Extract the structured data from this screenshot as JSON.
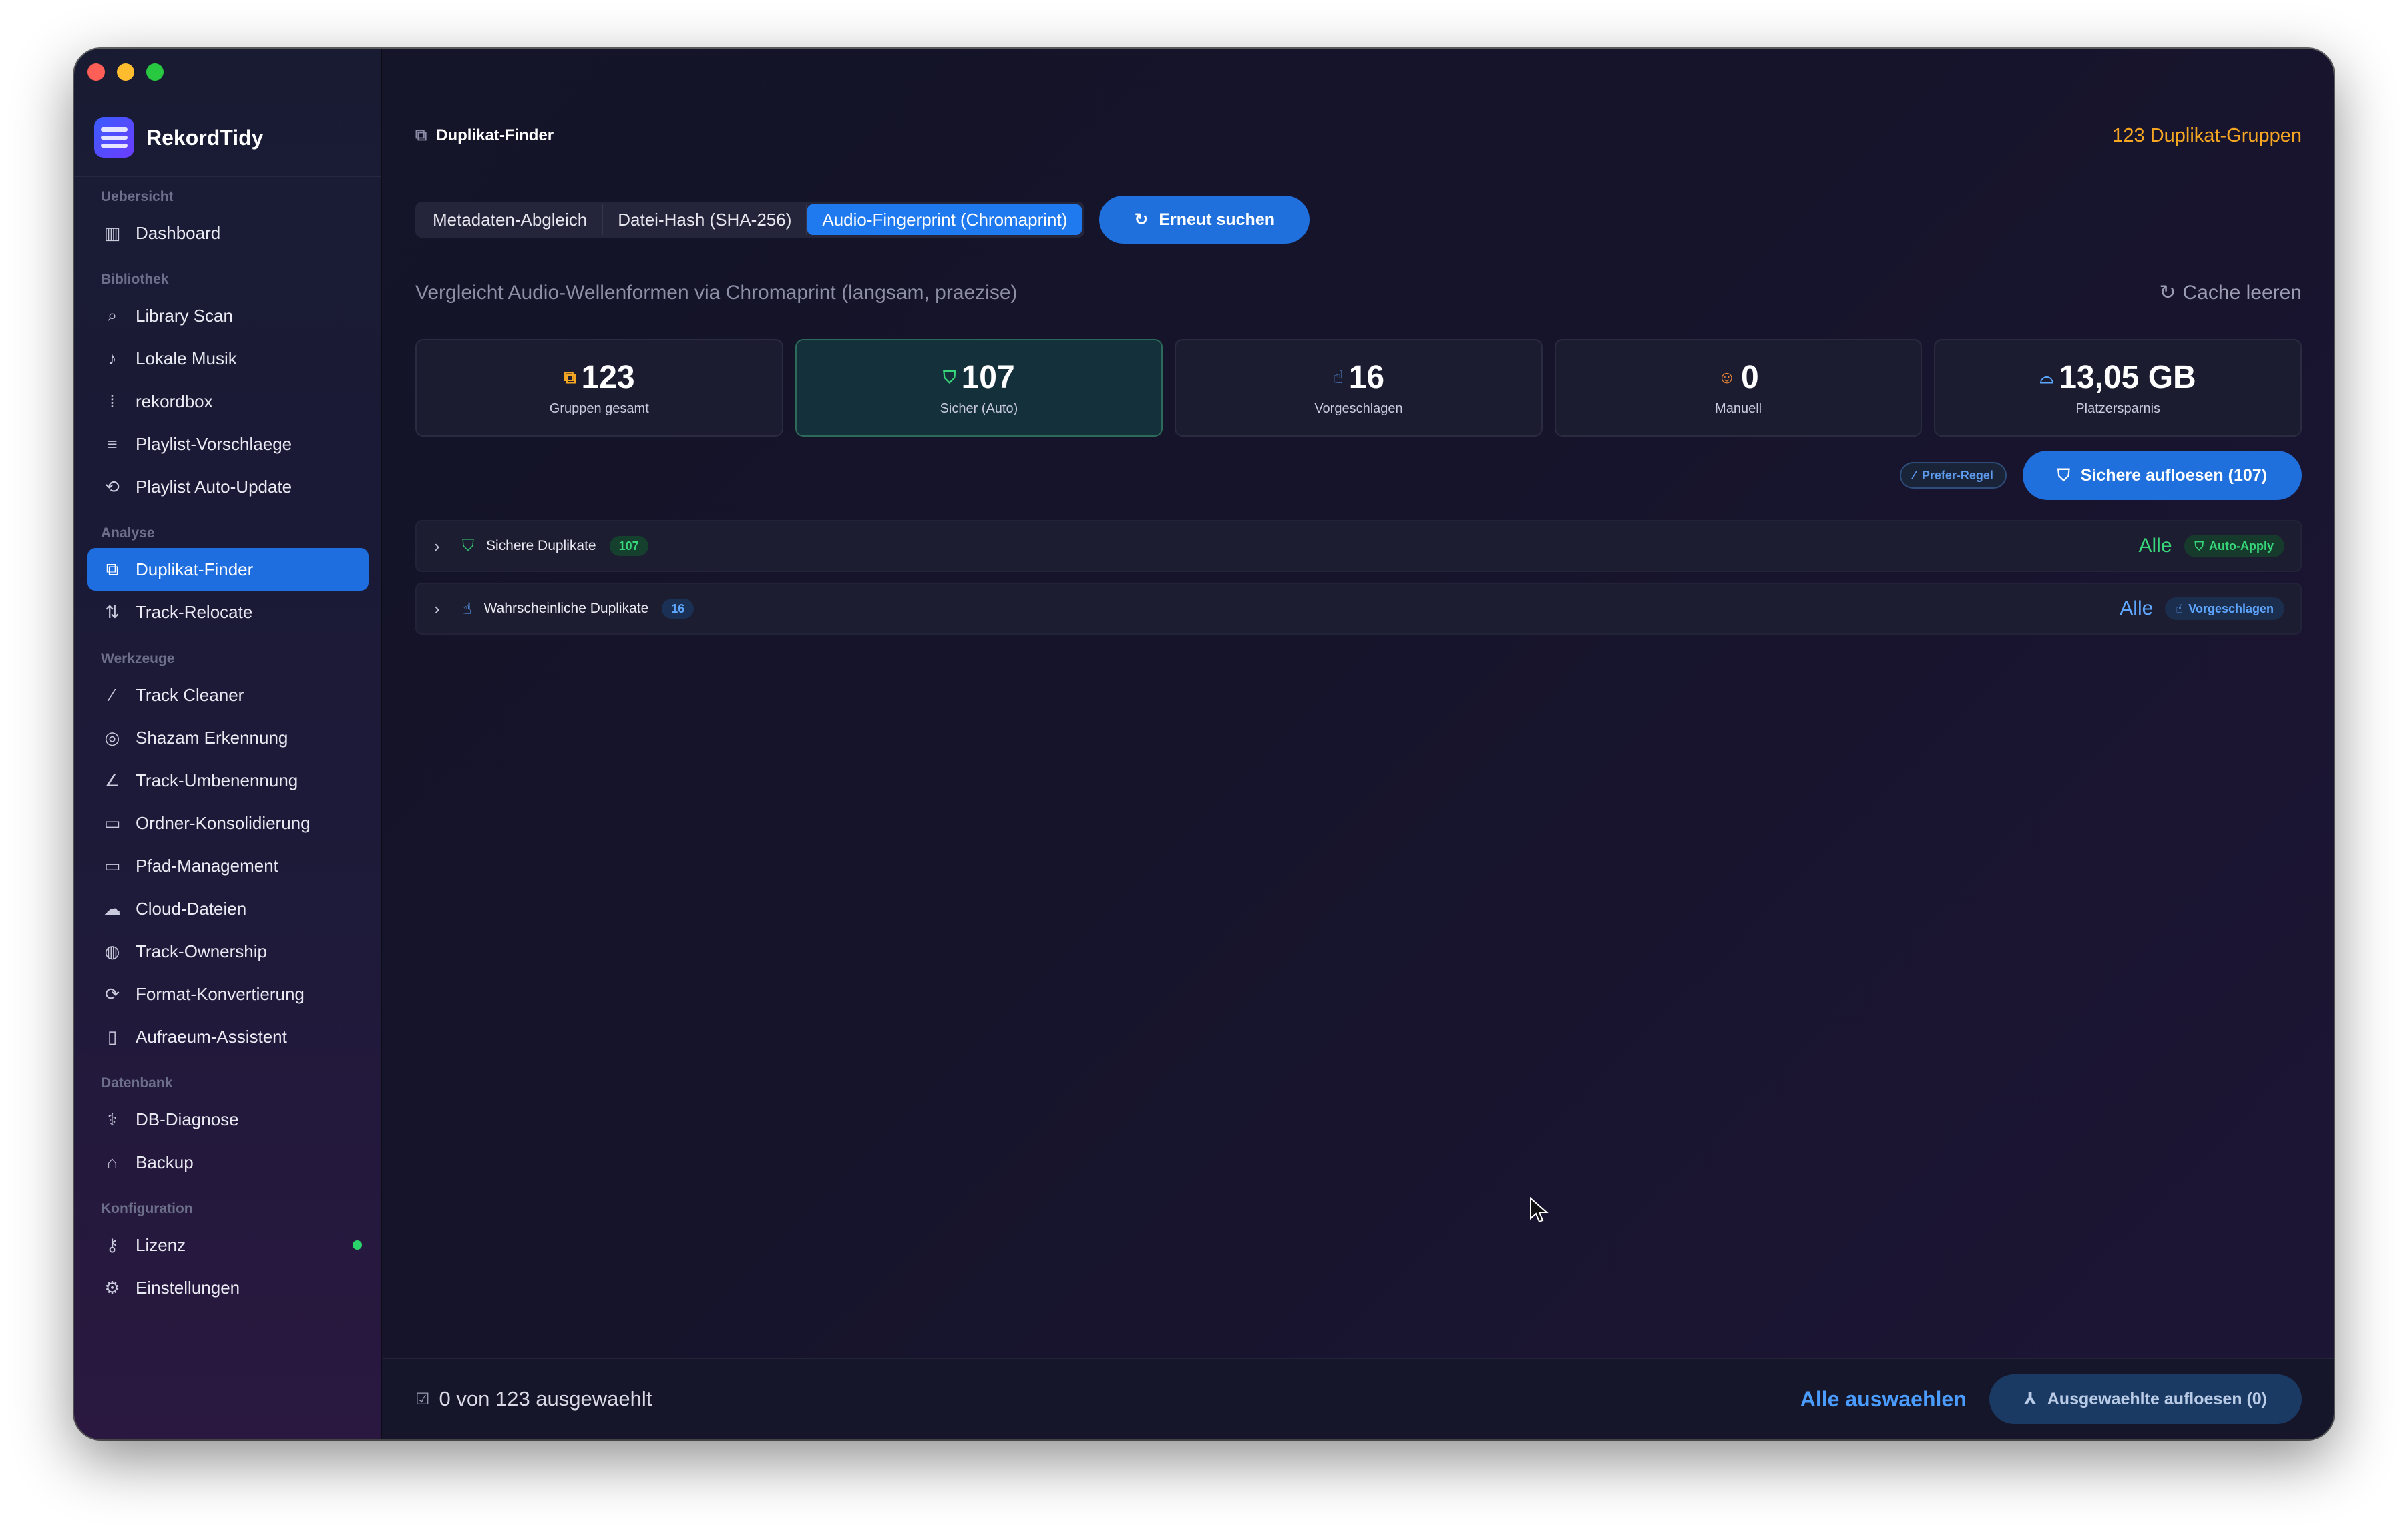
{
  "app": {
    "name": "RekordTidy"
  },
  "sidebar": {
    "sections": {
      "uebersicht": "Uebersicht",
      "bibliothek": "Bibliothek",
      "analyse": "Analyse",
      "werkzeuge": "Werkzeuge",
      "datenbank": "Datenbank",
      "konfiguration": "Konfiguration"
    },
    "items": {
      "dashboard": "Dashboard",
      "library_scan": "Library Scan",
      "lokale_musik": "Lokale Musik",
      "rekordbox": "rekordbox",
      "playlist_vorschlaege": "Playlist-Vorschlaege",
      "playlist_auto_update": "Playlist Auto-Update",
      "duplikat_finder": "Duplikat-Finder",
      "track_relocate": "Track-Relocate",
      "track_cleaner": "Track Cleaner",
      "shazam": "Shazam Erkennung",
      "track_umbenennung": "Track-Umbenennung",
      "ordner_konsolidierung": "Ordner-Konsolidierung",
      "pfad_management": "Pfad-Management",
      "cloud_dateien": "Cloud-Dateien",
      "track_ownership": "Track-Ownership",
      "format_konvertierung": "Format-Konvertierung",
      "aufraeum_assistent": "Aufraeum-Assistent",
      "db_diagnose": "DB-Diagnose",
      "backup": "Backup",
      "lizenz": "Lizenz",
      "einstellungen": "Einstellungen"
    },
    "active_item": "Duplikat-Finder"
  },
  "header": {
    "title": "Duplikat-Finder",
    "group_count": "123 Duplikat-Gruppen"
  },
  "modes": {
    "tabs": [
      "Metadaten-Abgleich",
      "Datei-Hash (SHA-256)",
      "Audio-Fingerprint (Chromaprint)"
    ],
    "active": "Audio-Fingerprint (Chromaprint)",
    "rescan_label": "Erneut suchen"
  },
  "description": "Vergleicht Audio-Wellenformen via Chromaprint (langsam, praezise)",
  "cache_label": "Cache leeren",
  "stats": [
    {
      "value": "123",
      "label": "Gruppen gesamt",
      "icon": "duplicate-icon",
      "color": "#f5a623"
    },
    {
      "value": "107",
      "label": "Sicher (Auto)",
      "icon": "shield-check-icon",
      "color": "#37d67a"
    },
    {
      "value": "16",
      "label": "Vorgeschlagen",
      "icon": "thumbs-up-icon",
      "color": "#5ea6ff"
    },
    {
      "value": "0",
      "label": "Manuell",
      "icon": "person-icon",
      "color": "#f58a3a"
    },
    {
      "value": "13,05 GB",
      "label": "Platzersparnis",
      "icon": "drive-icon",
      "color": "#5ea6ff"
    }
  ],
  "actions": {
    "prefer_rule": "Prefer-Regel",
    "resolve_safe": "Sichere aufloesen (107)"
  },
  "groups": [
    {
      "title": "Sichere Duplikate",
      "count": "107",
      "all": "Alle",
      "tag": "Auto-Apply",
      "icon": "shield-check-icon"
    },
    {
      "title": "Wahrscheinliche Duplikate",
      "count": "16",
      "all": "Alle",
      "tag": "Vorgeschlagen",
      "icon": "thumbs-up-icon"
    }
  ],
  "footer": {
    "selection": "0 von 123 ausgewaehlt",
    "select_all": "Alle auswaehlen",
    "resolve_selected": "Ausgewaehlte aufloesen (0)"
  },
  "colors": {
    "accent": "#1f6fdc",
    "warning": "#f5a623",
    "success": "#37d67a",
    "info": "#5ea6ff"
  }
}
